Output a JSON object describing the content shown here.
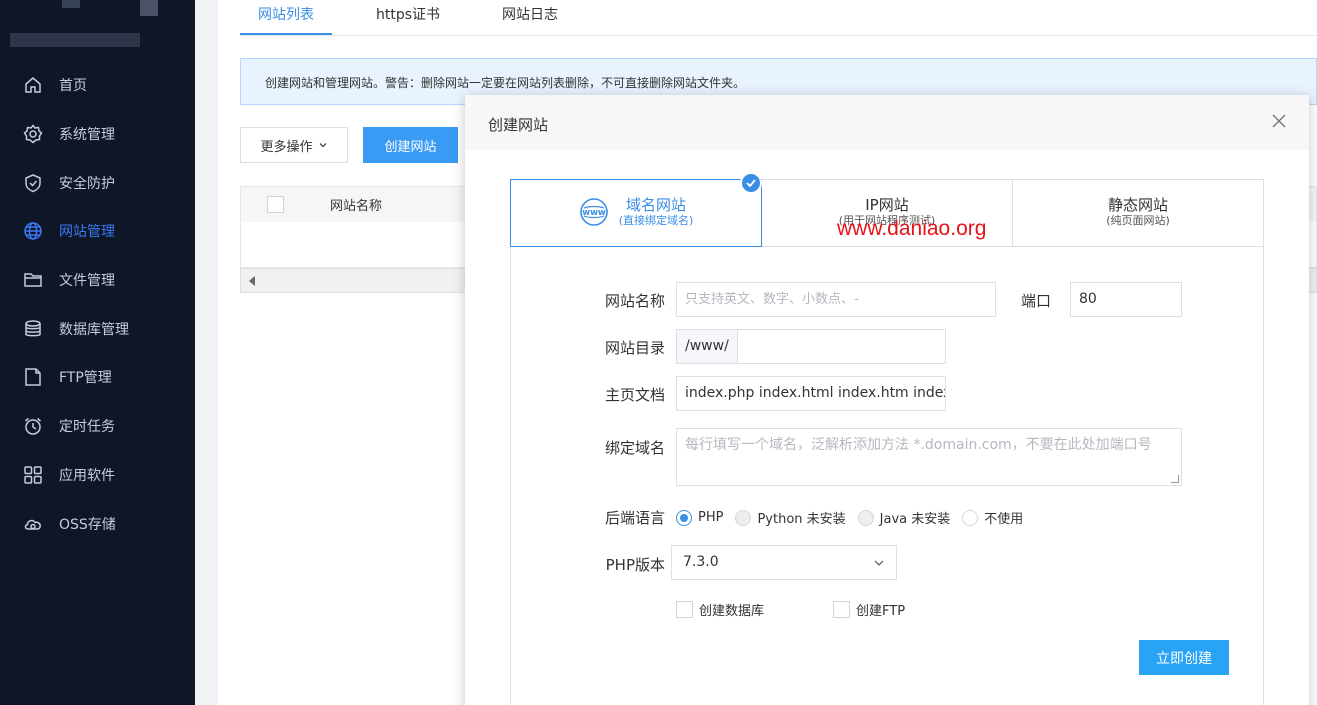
{
  "sidebar": {
    "items": [
      {
        "label": "首页",
        "icon": "home-icon"
      },
      {
        "label": "系统管理",
        "icon": "gear-icon"
      },
      {
        "label": "安全防护",
        "icon": "shield-icon"
      },
      {
        "label": "网站管理",
        "icon": "globe-icon",
        "active": true
      },
      {
        "label": "文件管理",
        "icon": "folder-icon"
      },
      {
        "label": "数据库管理",
        "icon": "database-icon"
      },
      {
        "label": "FTP管理",
        "icon": "ftp-icon"
      },
      {
        "label": "定时任务",
        "icon": "alarm-clock-icon"
      },
      {
        "label": "应用软件",
        "icon": "apps-grid-icon"
      },
      {
        "label": "OSS存储",
        "icon": "cloud-storage-icon"
      }
    ],
    "active_color": "#3a78f2"
  },
  "tabs": [
    {
      "label": "网站列表",
      "active": true
    },
    {
      "label": "https证书"
    },
    {
      "label": "网站日志"
    }
  ],
  "notice": "创建网站和管理网站。警告：删除网站一定要在网站列表删除，不可直接删除网站文件夹。",
  "toolbar": {
    "more_label": "更多操作",
    "create_label": "创建网站"
  },
  "table": {
    "columns": [
      "网站名称"
    ]
  },
  "dialog": {
    "title": "创建网站",
    "watermark": "www.daniao.org",
    "types": [
      {
        "name": "域名网站",
        "sub": "(直接绑定域名)",
        "active": true,
        "icon": "www-icon"
      },
      {
        "name": "IP网站",
        "sub": "(用于网站程序测试)"
      },
      {
        "name": "静态网站",
        "sub": "(纯页面网站)"
      }
    ],
    "form": {
      "site_name_label": "网站名称",
      "site_name_placeholder": "只支持英文、数字、小数点、-",
      "port_label": "端口",
      "port_value": "80",
      "dir_label": "网站目录",
      "dir_prefix": "/www/",
      "dir_value": "",
      "index_label": "主页文档",
      "index_value": "index.php index.html index.htm index",
      "domain_label": "绑定域名",
      "domain_placeholder": "每行填写一个域名，泛解析添加方法 *.domain.com，不要在此处加端口号",
      "backend_label": "后端语言",
      "backend_options": [
        {
          "label": "PHP",
          "checked": true
        },
        {
          "label": "Python 未安装",
          "disabled": true
        },
        {
          "label": "Java 未安装",
          "disabled": true
        },
        {
          "label": "不使用"
        }
      ],
      "php_label": "PHP版本",
      "php_value": "7.3.0",
      "create_db_label": "创建数据库",
      "create_ftp_label": "创建FTP",
      "submit_label": "立即创建"
    },
    "accent": "#3a8ee6"
  }
}
